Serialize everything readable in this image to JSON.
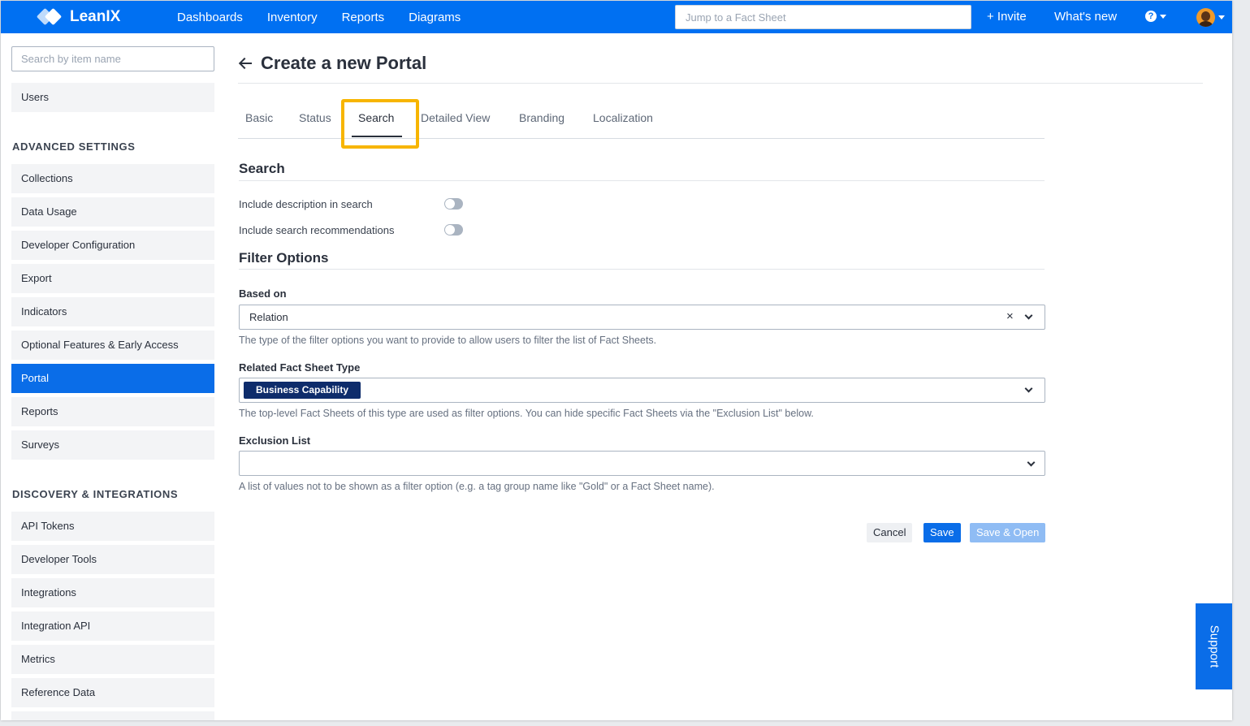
{
  "topbar": {
    "brand": "LeanIX",
    "nav": [
      "Dashboards",
      "Inventory",
      "Reports",
      "Diagrams"
    ],
    "jump_placeholder": "Jump to a Fact Sheet",
    "invite": "+ Invite",
    "whats_new": "What's new",
    "help_icon": "?"
  },
  "sidebar": {
    "search_placeholder": "Search by item name",
    "top_items": [
      "Users"
    ],
    "advanced_heading": "ADVANCED SETTINGS",
    "advanced_items": [
      "Collections",
      "Data Usage",
      "Developer Configuration",
      "Export",
      "Indicators",
      "Optional Features & Early Access",
      "Portal",
      "Reports",
      "Surveys"
    ],
    "active_item": "Portal",
    "discovery_heading": "DISCOVERY & INTEGRATIONS",
    "discovery_items": [
      "API Tokens",
      "Developer Tools",
      "Integrations",
      "Integration API",
      "Metrics",
      "Reference Data"
    ]
  },
  "page": {
    "title": "Create a new Portal",
    "tabs": [
      "Basic",
      "Status",
      "Search",
      "Detailed View",
      "Branding",
      "Localization"
    ],
    "active_tab": "Search"
  },
  "search_section": {
    "title": "Search",
    "toggles": [
      {
        "label": "Include description in search",
        "on": false
      },
      {
        "label": "Include search recommendations",
        "on": false
      }
    ]
  },
  "filter_section": {
    "title": "Filter Options",
    "based_on": {
      "label": "Based on",
      "value": "Relation",
      "help": "The type of the filter options you want to provide to allow users to filter the list of Fact Sheets."
    },
    "related_type": {
      "label": "Related Fact Sheet Type",
      "chip": "Business Capability",
      "help": "The top-level Fact Sheets of this type are used as filter options. You can hide specific Fact Sheets via the \"Exclusion List\" below."
    },
    "exclusion": {
      "label": "Exclusion List",
      "value": "",
      "help": "A list of values not to be shown as a filter option (e.g. a tag group name like \"Gold\" or a Fact Sheet name)."
    }
  },
  "actions": {
    "cancel": "Cancel",
    "save": "Save",
    "save_open": "Save & Open"
  },
  "support": "Support",
  "colors": {
    "brand_blue": "#0070f2",
    "active_blue": "#0a6de8",
    "highlight": "#f7b500",
    "chip": "#0e2c6b"
  }
}
